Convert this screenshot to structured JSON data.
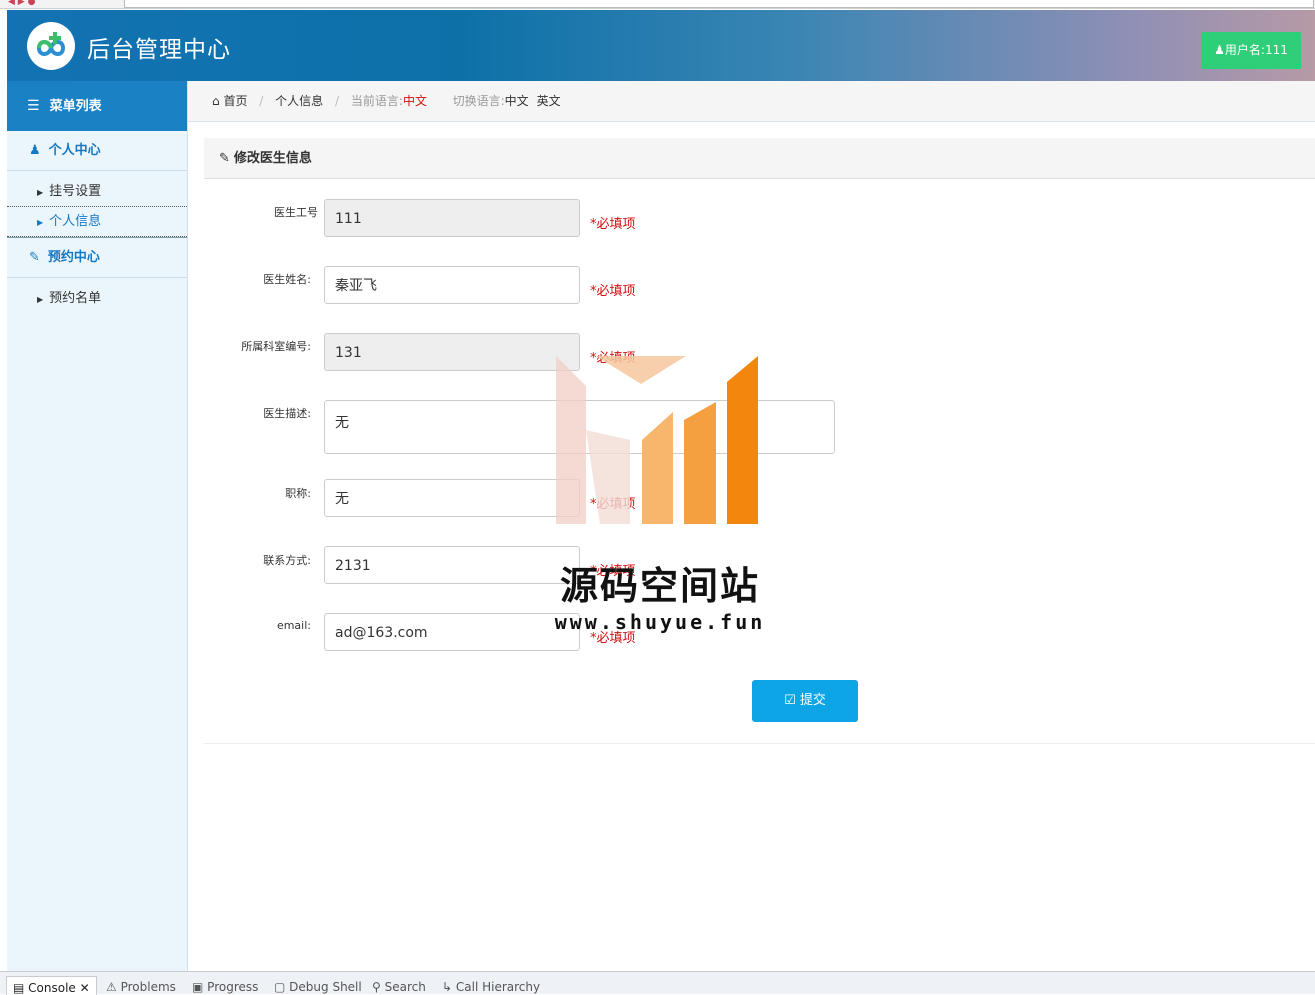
{
  "browser": {
    "address": ""
  },
  "header": {
    "app_title": "后台管理中心",
    "user_label": "用户名:111"
  },
  "sidebar": {
    "menu_title": "菜单列表",
    "groups": [
      {
        "label": "个人中心",
        "items": [
          {
            "label": "挂号设置"
          },
          {
            "label": "个人信息"
          }
        ]
      },
      {
        "label": "预约中心",
        "items": [
          {
            "label": "预约名单"
          }
        ]
      }
    ]
  },
  "breadcrumb": {
    "home": "首页",
    "current": "个人信息",
    "current_lang_label": "当前语言:",
    "current_lang": "中文",
    "switch_lang_label": "切换语言:",
    "lang_zh": "中文",
    "lang_en": "英文"
  },
  "panel": {
    "title": "修改医生信息"
  },
  "form": {
    "fields": [
      {
        "label": "医生工号",
        "value": "111",
        "required": "*必填项"
      },
      {
        "label": "医生姓名:",
        "value": "秦亚飞",
        "required": "*必填项"
      },
      {
        "label": "所属科室编号:",
        "value": "131",
        "required": "*必填项"
      },
      {
        "label": "医生描述:",
        "value": "无"
      },
      {
        "label": "职称:",
        "value": "无",
        "required": "*必填项"
      },
      {
        "label": "联系方式:",
        "value": "2131",
        "required": "*必填项"
      },
      {
        "label": "email:",
        "value": "ad@163.com",
        "required": "*必填项"
      }
    ],
    "submit_label": "提交"
  },
  "watermark": {
    "title": "源码空间站",
    "url": "www.shuyue.fun"
  },
  "ide_tabs": [
    "Console",
    "Problems",
    "Progress",
    "Debug Shell",
    "Search",
    "Call Hierarchy"
  ],
  "colors": {
    "header_start": "#1372b3",
    "sidebar_head": "#1981c4",
    "accent_blue": "#1578c4",
    "user_button": "#2fce78",
    "submit_button": "#0ea5e6",
    "required_red": "#d01111"
  }
}
